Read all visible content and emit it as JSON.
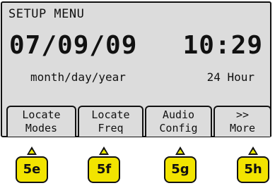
{
  "screen": {
    "title": "SETUP MENU",
    "date": "07/09/09",
    "time": "10:29",
    "date_format": "month/day/year",
    "time_format": "24 Hour"
  },
  "softkeys": [
    {
      "line1": "Locate",
      "line2": "Modes"
    },
    {
      "line1": "Locate",
      "line2": "Freq"
    },
    {
      "line1": "Audio",
      "line2": "Config"
    },
    {
      "line1": ">>",
      "line2": "More"
    }
  ],
  "buttons": [
    "5e",
    "5f",
    "5g",
    "5h"
  ],
  "colors": {
    "button_fill": "#f2e400",
    "lcd_background": "#dcdcdc",
    "text": "#111111"
  }
}
